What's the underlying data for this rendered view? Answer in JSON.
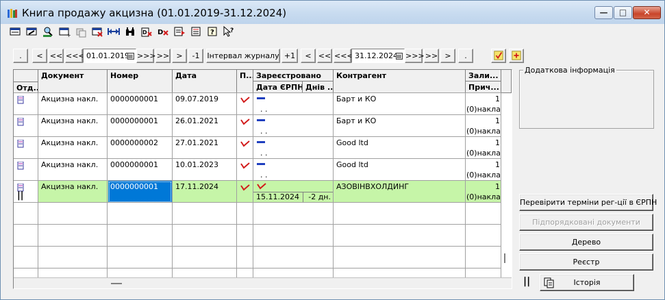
{
  "window": {
    "title": "Книга продажу акцизна (01.01.2019-31.12.2024)",
    "buttons": {
      "minimize": "—",
      "maximize": "□",
      "close": "✕"
    }
  },
  "toolbar": {
    "icons": [
      "new-doc-icon",
      "edit-doc-icon",
      "search-doc-icon",
      "add-doc-icon",
      "copy-doc-icon",
      "delete-doc-icon",
      "move-icon",
      "binoculars-icon",
      "print-delete-icon",
      "dx-icon",
      "export-icon",
      "list-icon",
      "help-icon",
      "whats-this-icon"
    ]
  },
  "nav": {
    "left": {
      "dot": ".",
      "prev": "<",
      "prev2": "<<",
      "prev3": "<<<",
      "date": "01.01.2019",
      "next3": ">>>",
      "next2": ">>",
      "next": ">",
      "minus1": "-1"
    },
    "interval": "Інтервал журналу",
    "right": {
      "plus1": "+1",
      "prev": "<",
      "prev2": "<<",
      "prev3": "<<<",
      "date": "31.12.2024",
      "next3": ">>>",
      "next2": ">>",
      "next": ">",
      "dot": "."
    }
  },
  "grid": {
    "headers": {
      "otd": "Отд...",
      "document": "Документ",
      "number": "Номер",
      "date": "Дата",
      "p": "П...",
      "registered": "Зареєстровано",
      "reg_date": "Дата ЄРПН",
      "reg_days": "Днів ...",
      "counterparty": "Контрагент",
      "remainder": "Зали...",
      "reason": "Прич..."
    },
    "rows": [
      {
        "document": "Акцизна накл.",
        "number": "0000000001",
        "date": "09.07.2019",
        "reg_date": ". .",
        "reg_days": "",
        "counterparty": "Барт и КО",
        "remainder": "1",
        "reason": "(0)накла",
        "registered": false,
        "selected": false
      },
      {
        "document": "Акцизна накл.",
        "number": "0000000001",
        "date": "26.01.2021",
        "reg_date": ". .",
        "reg_days": "",
        "counterparty": "Барт и КО",
        "remainder": "1",
        "reason": "(0)накла",
        "registered": false,
        "selected": false
      },
      {
        "document": "Акцизна накл.",
        "number": "0000000002",
        "date": "27.01.2021",
        "reg_date": ". .",
        "reg_days": "",
        "counterparty": "Good ltd",
        "remainder": "1",
        "reason": "(0)накла",
        "registered": false,
        "selected": false
      },
      {
        "document": "Акцизна накл.",
        "number": "0000000001",
        "date": "10.01.2023",
        "reg_date": ". .",
        "reg_days": "",
        "counterparty": "Good ltd",
        "remainder": "1",
        "reason": "(0)накла",
        "registered": false,
        "selected": false
      },
      {
        "document": "Акцизна накл.",
        "number": "0000000001",
        "date": "17.11.2024",
        "reg_date": "15.11.2024",
        "reg_days": "-2 дн.",
        "counterparty": "АЗОВІНВХОЛДИНГ",
        "remainder": "1",
        "reason": "(0)накла",
        "registered": true,
        "selected": true
      }
    ],
    "selected_marker": "||"
  },
  "side": {
    "extra_info_title": "Додаткова інформація",
    "check_terms": "Перевірити терміни рег-ції в ЄРПН",
    "unregistered": "Підпорядковані документи",
    "tree": "Дерево",
    "registry": "Реєстр",
    "history": "Історія",
    "pause": "||"
  },
  "colors": {
    "row_highlight": "#c6f5a8",
    "cell_selected": "#0078d7",
    "check_red": "#d21c1c",
    "dash_blue": "#1f3fbf"
  }
}
